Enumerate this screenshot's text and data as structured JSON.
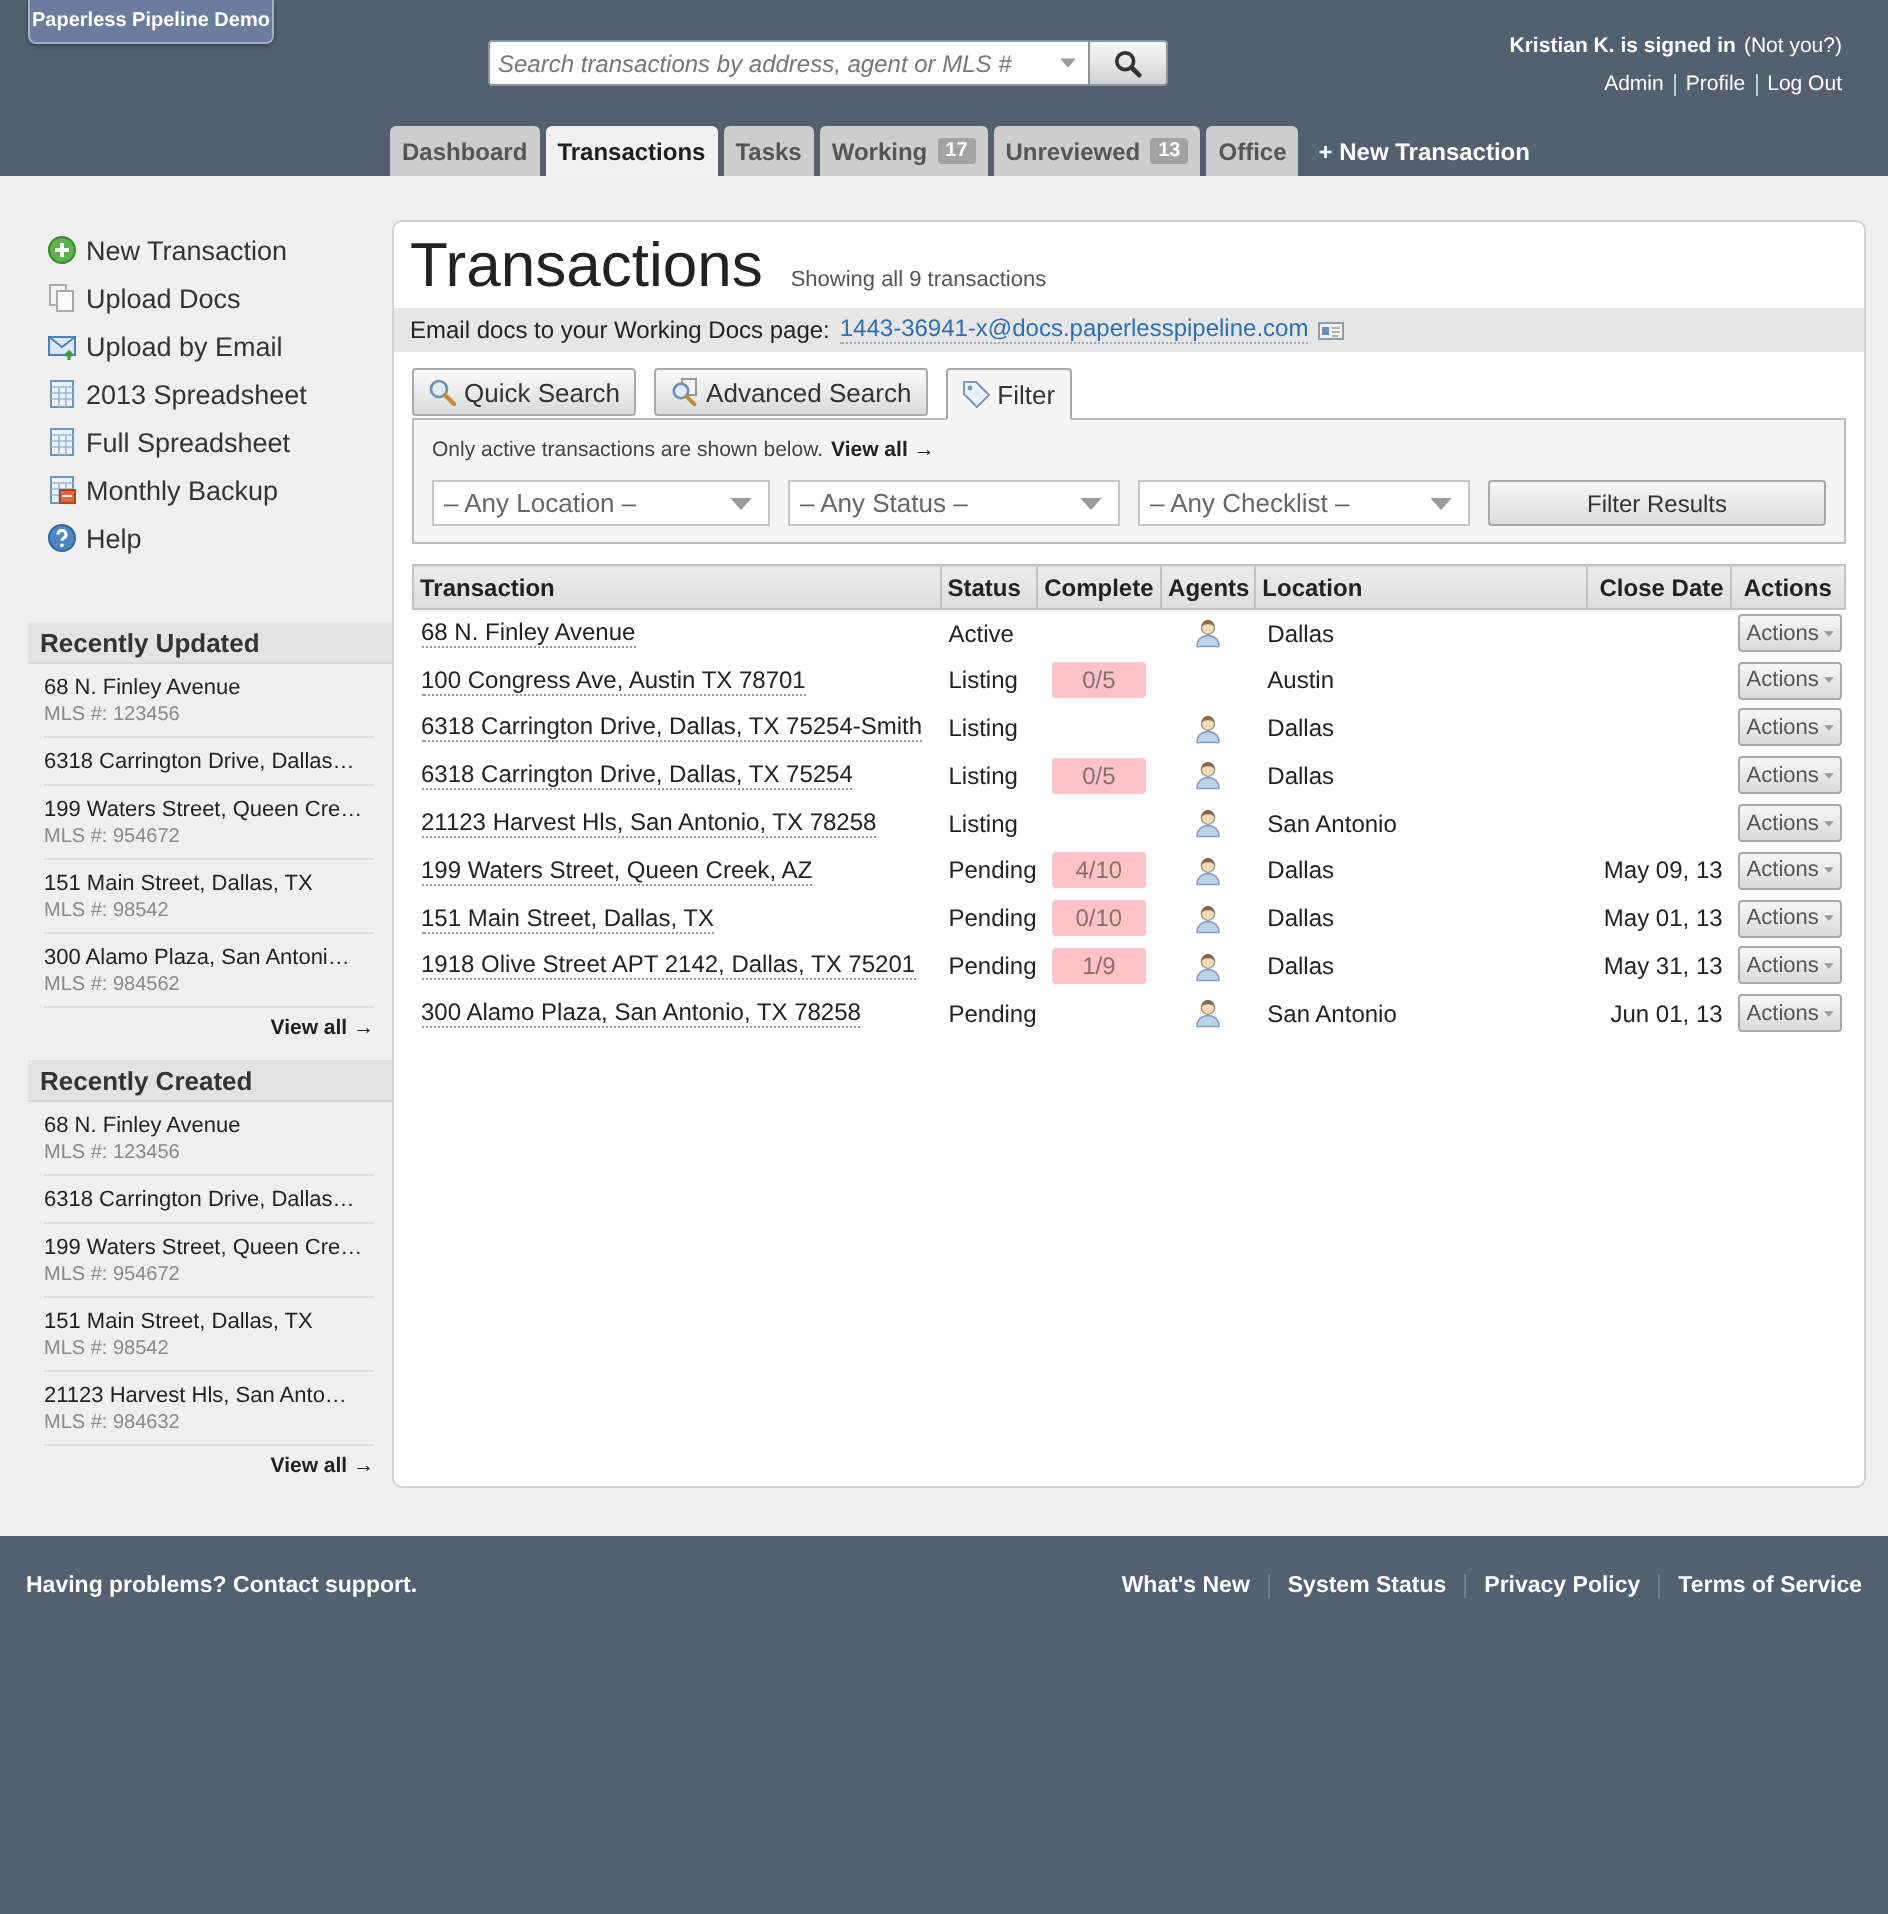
{
  "header": {
    "logo": "Paperless Pipeline Demo",
    "search": {
      "placeholder": "Search transactions by address, agent or MLS #"
    },
    "user": {
      "signed_in": "Kristian K. is signed in",
      "not_you": "(Not you?)",
      "links": [
        "Admin",
        "Profile",
        "Log Out"
      ]
    }
  },
  "nav_tabs": [
    {
      "label": "Dashboard",
      "selected": false
    },
    {
      "label": "Transactions",
      "selected": true
    },
    {
      "label": "Tasks",
      "selected": false
    },
    {
      "label": "Working",
      "count": "17",
      "selected": false
    },
    {
      "label": "Unreviewed",
      "count": "13",
      "selected": false
    },
    {
      "label": "Office",
      "selected": false
    }
  ],
  "new_transaction_link": "+ New Transaction",
  "sidebar": {
    "actions": [
      {
        "kind": "add",
        "label": "New Transaction"
      },
      {
        "kind": "upload",
        "label": "Upload Docs"
      },
      {
        "kind": "email",
        "label": "Upload by Email"
      },
      {
        "kind": "spreadsheet",
        "label": "2013 Spreadsheet"
      },
      {
        "kind": "spreadsheet",
        "label": "Full Spreadsheet"
      },
      {
        "kind": "backup",
        "label": "Monthly Backup"
      },
      {
        "kind": "help",
        "label": "Help"
      }
    ],
    "sections": [
      {
        "title": "Recently Updated",
        "items": [
          {
            "address": "68 N. Finley Avenue",
            "mls": "MLS #: 123456"
          },
          {
            "address": "6318 Carrington Drive, Dallas…"
          },
          {
            "address": "199 Waters Street, Queen Cre…",
            "mls": "MLS #: 954672"
          },
          {
            "address": "151 Main Street, Dallas, TX",
            "mls": "MLS #: 98542"
          },
          {
            "address": "300 Alamo Plaza, San Antoni…",
            "mls": "MLS #: 984562"
          }
        ],
        "view_all": "View all →"
      },
      {
        "title": "Recently Created",
        "items": [
          {
            "address": "68 N. Finley Avenue",
            "mls": "MLS #: 123456"
          },
          {
            "address": "6318 Carrington Drive, Dallas…"
          },
          {
            "address": "199 Waters Street, Queen Cre…",
            "mls": "MLS #: 954672"
          },
          {
            "address": "151 Main Street, Dallas, TX",
            "mls": "MLS #: 98542"
          },
          {
            "address": "21123 Harvest Hls, San Anto…",
            "mls": "MLS #: 984632"
          }
        ],
        "view_all": "View all →"
      }
    ]
  },
  "main": {
    "title": "Transactions",
    "subtitle": "Showing all 9 transactions",
    "email": {
      "label": "Email docs to your Working Docs page:",
      "address": "1443-36941-x@docs.paperlesspipeline.com"
    },
    "search_tabs": [
      {
        "kind": "quick",
        "label": "Quick Search",
        "selected": false
      },
      {
        "kind": "advanced",
        "label": "Advanced Search",
        "selected": false
      },
      {
        "kind": "filter",
        "label": "Filter",
        "selected": true
      }
    ],
    "filter": {
      "note": "Only active transactions are shown below.",
      "view_all": "View all →",
      "dropdowns": [
        {
          "value": "– Any Location –"
        },
        {
          "value": "– Any Status –"
        },
        {
          "value": "– Any Checklist –"
        }
      ],
      "button": "Filter Results"
    },
    "table": {
      "columns": [
        "Transaction",
        "Status",
        "Complete",
        "Agents",
        "Location",
        "Close Date",
        "Actions"
      ],
      "rows": [
        {
          "transaction": "68 N. Finley Avenue",
          "status": "Active",
          "agent": true,
          "location": "Dallas",
          "action": "Actions"
        },
        {
          "transaction": "100 Congress Ave, Austin TX 78701",
          "status": "Listing",
          "complete": "0/5",
          "agent": false,
          "location": "Austin",
          "action": "Actions"
        },
        {
          "transaction": "6318 Carrington Drive, Dallas, TX 75254-Smith",
          "status": "Listing",
          "agent": true,
          "location": "Dallas",
          "action": "Actions"
        },
        {
          "transaction": "6318 Carrington Drive, Dallas, TX 75254",
          "status": "Listing",
          "complete": "0/5",
          "agent": true,
          "location": "Dallas",
          "action": "Actions"
        },
        {
          "transaction": "21123 Harvest Hls, San Antonio, TX 78258",
          "status": "Listing",
          "agent": true,
          "location": "San Antonio",
          "action": "Actions"
        },
        {
          "transaction": "199 Waters Street, Queen Creek, AZ",
          "status": "Pending",
          "complete": "4/10",
          "agent": true,
          "location": "Dallas",
          "close_date": "May 09, 13",
          "action": "Actions"
        },
        {
          "transaction": "151 Main Street, Dallas, TX",
          "status": "Pending",
          "complete": "0/10",
          "agent": true,
          "location": "Dallas",
          "close_date": "May 01, 13",
          "action": "Actions"
        },
        {
          "transaction": "1918 Olive Street APT 2142, Dallas, TX 75201",
          "status": "Pending",
          "complete": "1/9",
          "agent": true,
          "location": "Dallas",
          "close_date": "May 31, 13",
          "action": "Actions"
        },
        {
          "transaction": "300 Alamo Plaza, San Antonio, TX 78258",
          "status": "Pending",
          "agent": true,
          "location": "San Antonio",
          "close_date": "Jun 01, 13",
          "action": "Actions"
        }
      ]
    }
  },
  "footer": {
    "support": "Having problems? Contact support.",
    "links": [
      "What's New",
      "System Status",
      "Privacy Policy",
      "Terms of Service"
    ]
  }
}
